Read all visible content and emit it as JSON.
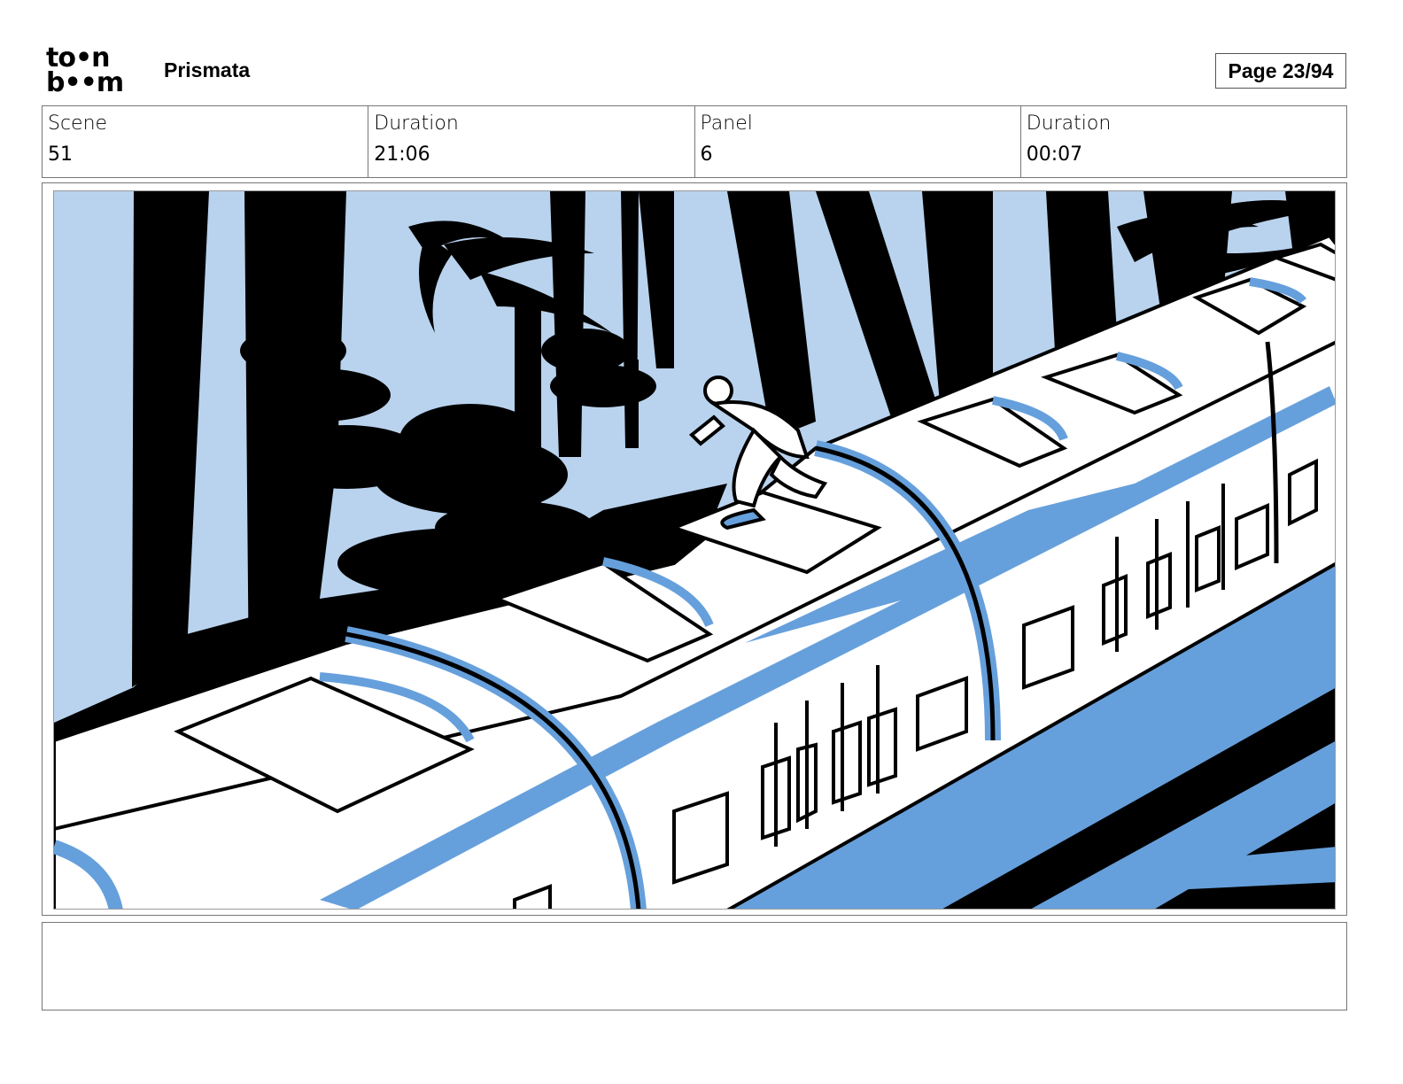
{
  "header": {
    "logo_line1": "to•n",
    "logo_line2": "b••m",
    "project_title": "Prismata",
    "page_label": "Page 23/94"
  },
  "info": {
    "scene_label": "Scene",
    "scene_value": "51",
    "scene_duration_label": "Duration",
    "scene_duration_value": "21:06",
    "panel_label": "Panel",
    "panel_value": "6",
    "panel_duration_label": "Duration",
    "panel_duration_value": "00:07"
  },
  "colors": {
    "sky": "#b9d3ee",
    "shadow_blue": "#66a0dc",
    "ink": "#000000",
    "paper": "#ffffff"
  },
  "notes": {
    "text": ""
  }
}
